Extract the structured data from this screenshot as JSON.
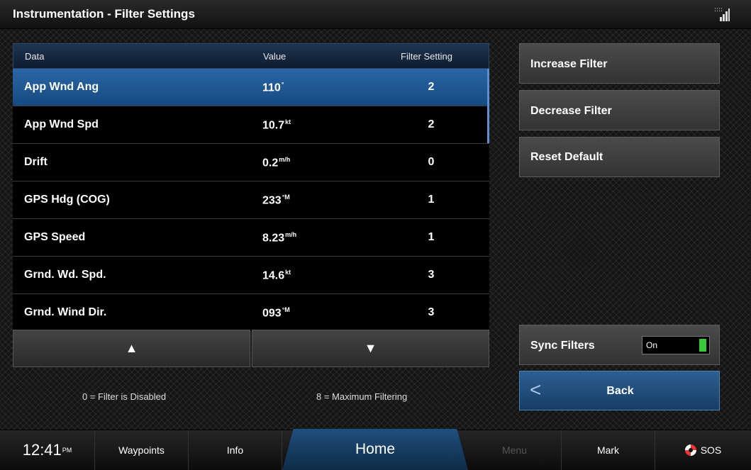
{
  "titlebar": {
    "title": "Instrumentation - Filter Settings",
    "signal_glyph": "::::"
  },
  "table": {
    "headers": {
      "data": "Data",
      "value": "Value",
      "filter": "Filter Setting"
    },
    "rows": [
      {
        "data": "App Wnd Ang",
        "value": "110",
        "unit": "°",
        "filter": "2",
        "selected": true
      },
      {
        "data": "App Wnd Spd",
        "value": "10.7",
        "unit": "kt",
        "filter": "2",
        "selected": false
      },
      {
        "data": "Drift",
        "value": "0.2",
        "unit": "m/h",
        "filter": "0",
        "selected": false
      },
      {
        "data": "GPS Hdg (COG)",
        "value": "233",
        "unit": "°M",
        "filter": "1",
        "selected": false
      },
      {
        "data": "GPS Speed",
        "value": "8.23",
        "unit": "m/h",
        "filter": "1",
        "selected": false
      },
      {
        "data": "Grnd. Wd. Spd.",
        "value": "14.6",
        "unit": "kt",
        "filter": "3",
        "selected": false
      },
      {
        "data": "Grnd. Wind Dir.",
        "value": "093",
        "unit": "°M",
        "filter": "3",
        "selected": false
      }
    ],
    "scroll_up_glyph": "▲",
    "scroll_down_glyph": "▼"
  },
  "legend": {
    "min": "0 = Filter is Disabled",
    "max": "8 = Maximum Filtering"
  },
  "side": {
    "increase": "Increase Filter",
    "decrease": "Decrease Filter",
    "reset": "Reset Default",
    "sync_label": "Sync Filters",
    "sync_value": "On",
    "back": "Back",
    "back_glyph": "<"
  },
  "bottombar": {
    "clock": "12:41",
    "clock_suffix": "PM",
    "waypoints": "Waypoints",
    "info": "Info",
    "home": "Home",
    "menu": "Menu",
    "mark": "Mark",
    "sos": "SOS"
  },
  "colors": {
    "accent": "#1f4f7f",
    "selected_row": "#2a66a6",
    "toggle_on": "#39c83a"
  }
}
